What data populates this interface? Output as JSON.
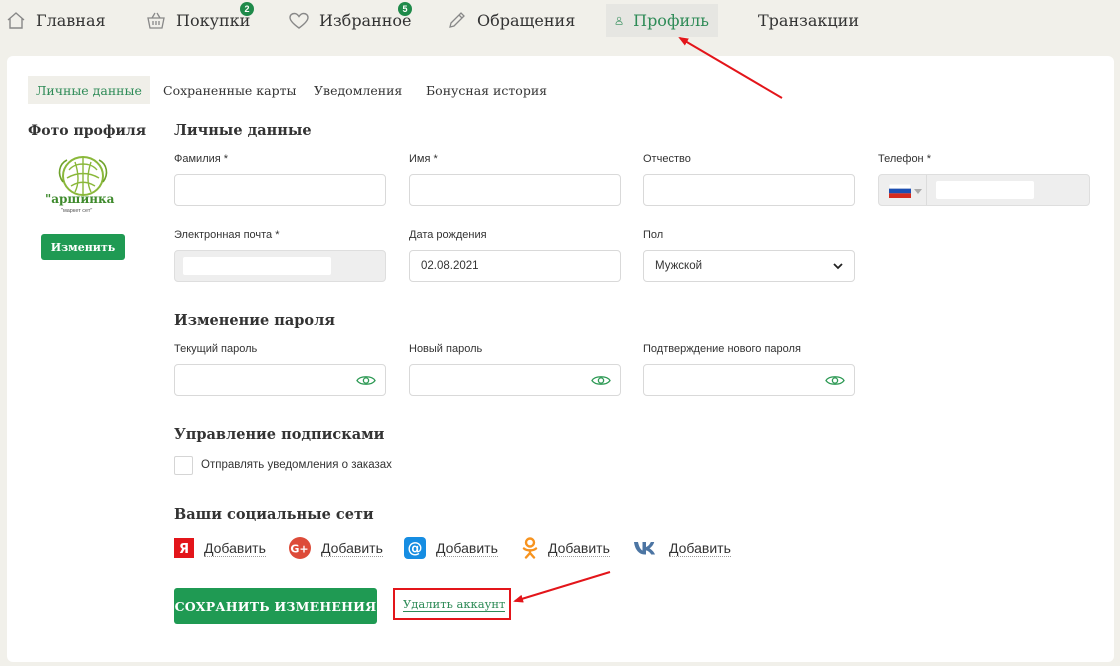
{
  "nav": {
    "items": [
      {
        "label": "Главная",
        "icon": "home-icon"
      },
      {
        "label": "Покупки",
        "icon": "basket-icon",
        "badge": "2"
      },
      {
        "label": "Избранное",
        "icon": "heart-icon",
        "badge": "5"
      },
      {
        "label": "Обращения",
        "icon": "pencil-icon"
      },
      {
        "label": "Профиль",
        "icon": "user-icon",
        "active": true
      },
      {
        "label": "Транзакции"
      }
    ]
  },
  "tabs": [
    "Личные данные",
    "Сохраненные карты",
    "Уведомления",
    "Бонусная история"
  ],
  "sidebar": {
    "title": "Фото профиля",
    "logo_text": "\"аршинка",
    "logo_subtext": "\"маркет сет\"",
    "change_button": "Изменить"
  },
  "personal": {
    "title": "Личные данные",
    "last_name": {
      "label": "Фамилия *",
      "value": ""
    },
    "first_name": {
      "label": "Имя *",
      "value": ""
    },
    "patronymic": {
      "label": "Отчество",
      "value": ""
    },
    "phone": {
      "label": "Телефон *",
      "country_flag": "russia-flag-icon",
      "value": ""
    },
    "email": {
      "label": "Электронная почта *",
      "value": ""
    },
    "birth_date": {
      "label": "Дата рождения",
      "value": "02.08.2021"
    },
    "gender": {
      "label": "Пол",
      "value": "Мужской"
    }
  },
  "password": {
    "title": "Изменение пароля",
    "current": {
      "label": "Текущий пароль"
    },
    "new": {
      "label": "Новый пароль"
    },
    "confirm": {
      "label": "Подтверждение нового пароля"
    }
  },
  "subscriptions": {
    "title": "Управление подписками",
    "order_notifications": {
      "label": "Отправлять уведомления о заказах",
      "checked": false
    }
  },
  "social": {
    "title": "Ваши социальные сети",
    "items": [
      {
        "service": "yandex",
        "icon": "yandex-icon",
        "label": "Добавить"
      },
      {
        "service": "google",
        "icon": "google-plus-icon",
        "label": "Добавить"
      },
      {
        "service": "mailru",
        "icon": "mailru-icon",
        "label": "Добавить"
      },
      {
        "service": "odnoklassniki",
        "icon": "odnoklassniki-icon",
        "label": "Добавить"
      },
      {
        "service": "vk",
        "icon": "vk-icon",
        "label": "Добавить"
      }
    ]
  },
  "actions": {
    "save": "СОХРАНИТЬ ИЗМЕНЕНИЯ",
    "delete_account": "Удалить аккаунт"
  },
  "colors": {
    "accent_green": "#1f9a53",
    "active_text": "#2e8b57",
    "annotation_red": "#e3151a"
  }
}
